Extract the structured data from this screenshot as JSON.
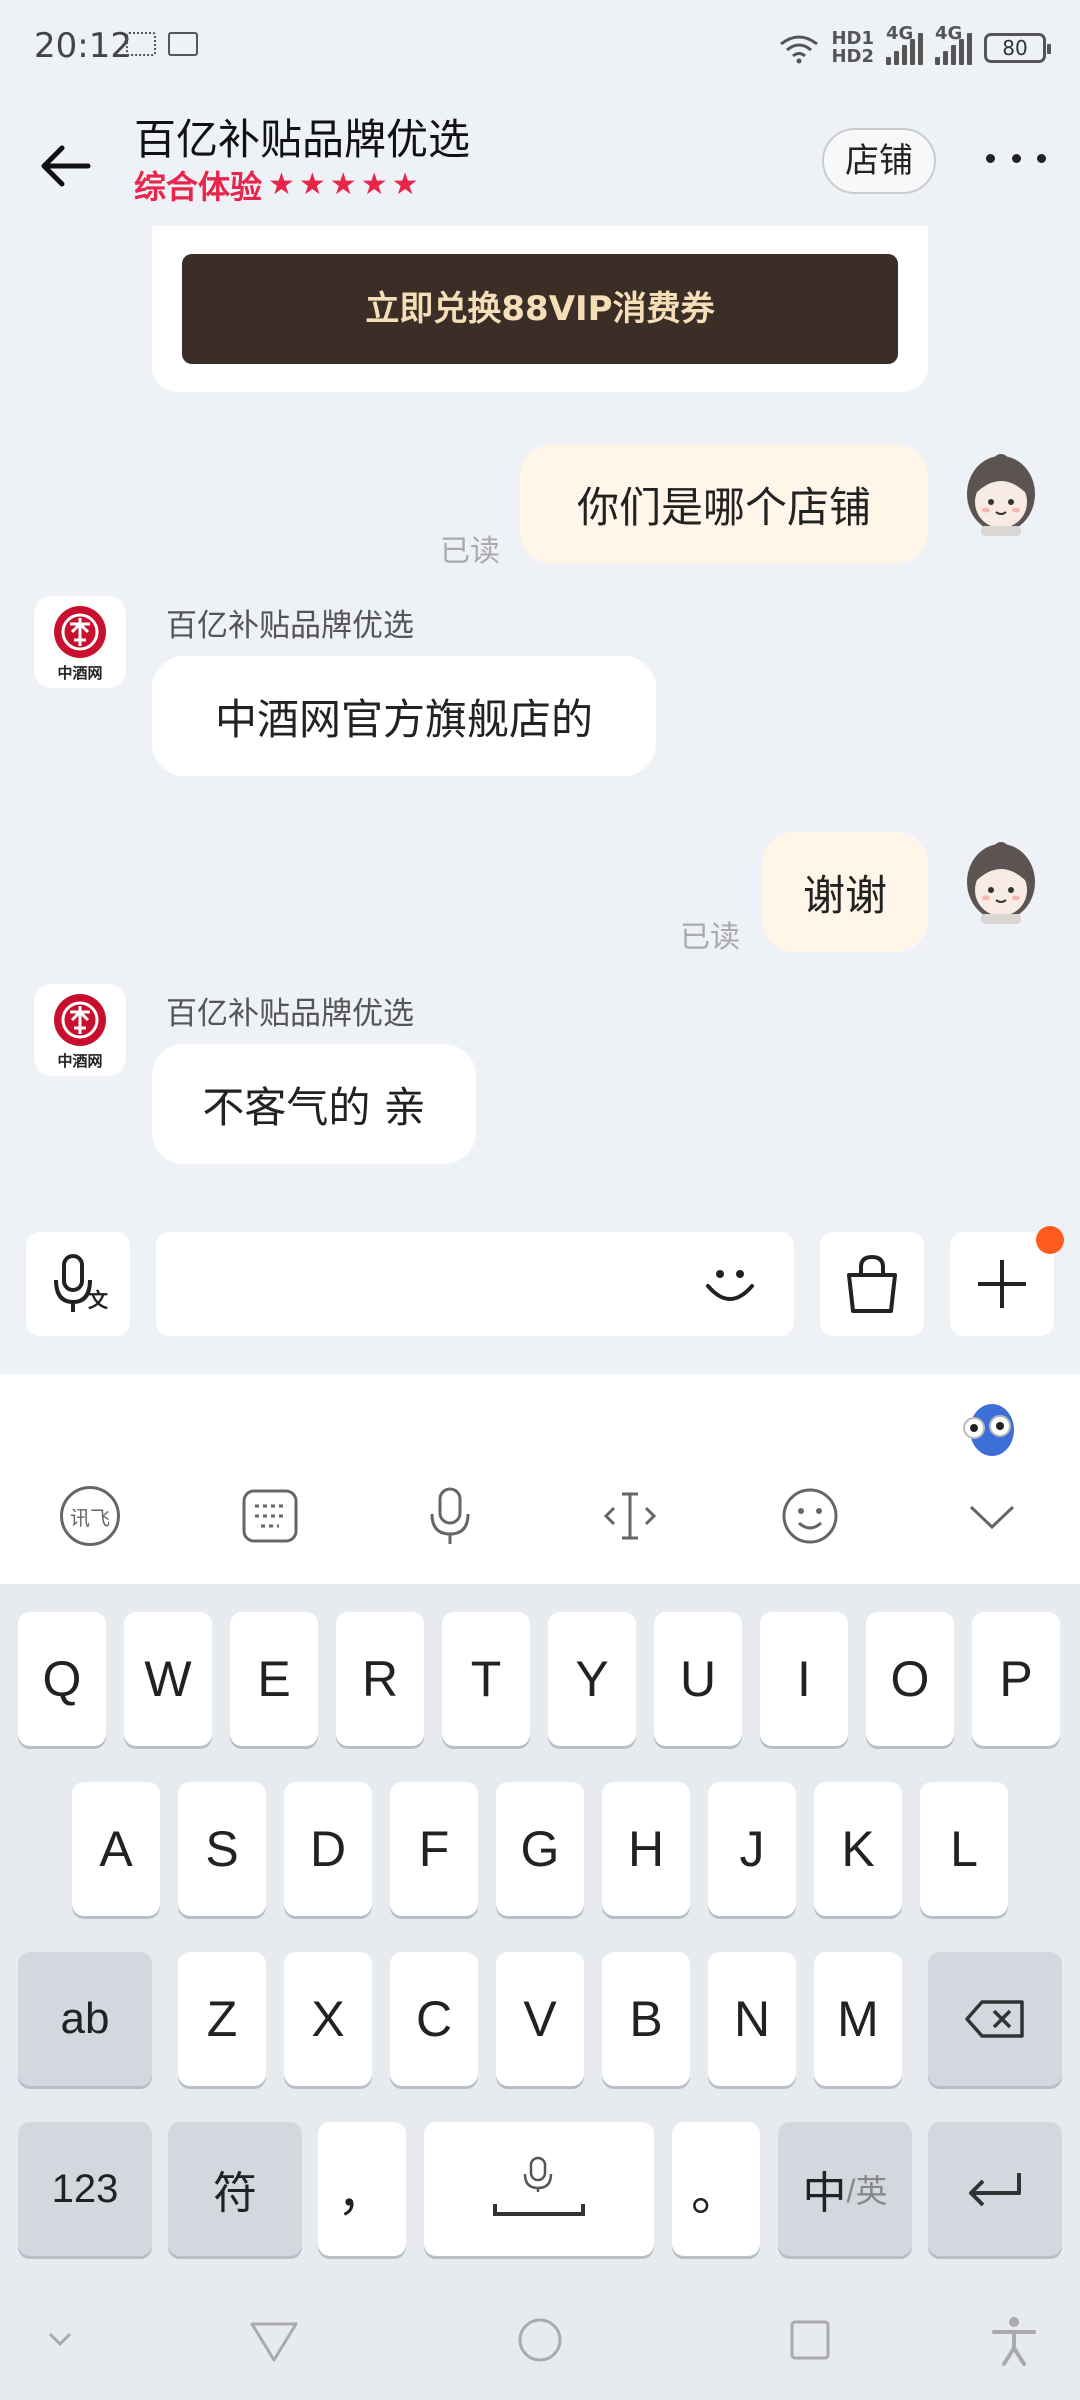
{
  "status_bar": {
    "time": "20:12",
    "network_labels": [
      "HD1",
      "HD2",
      "4G",
      "4G"
    ],
    "battery": "80"
  },
  "header": {
    "title": "百亿补贴品牌优选",
    "experience_label": "综合体验",
    "stars": "★★★★★",
    "store_button": "店铺"
  },
  "chat": {
    "promo_button": "立即兑换88VIP消费券",
    "messages": [
      {
        "sender": "me",
        "text": "你们是哪个店铺",
        "status": "已读"
      },
      {
        "sender": "shop",
        "name": "百亿补贴品牌优选",
        "text": "中酒网官方旗舰店的",
        "avatar_caption": "中酒网"
      },
      {
        "sender": "me",
        "text": "谢谢",
        "status": "已读"
      },
      {
        "sender": "shop",
        "name": "百亿补贴品牌优选",
        "text": "不客气的 亲",
        "avatar_caption": "中酒网"
      }
    ]
  },
  "input_bar": {
    "voice_icon_caption": "文",
    "text_value": "",
    "plus_has_badge": true
  },
  "keyboard": {
    "row1": [
      "Q",
      "W",
      "E",
      "R",
      "T",
      "Y",
      "U",
      "I",
      "O",
      "P"
    ],
    "row2": [
      "A",
      "S",
      "D",
      "F",
      "G",
      "H",
      "J",
      "K",
      "L"
    ],
    "row3": [
      "Z",
      "X",
      "C",
      "V",
      "B",
      "N",
      "M"
    ],
    "shift_label": "ab",
    "numbers_label": "123",
    "symbols_label": "符",
    "comma_label": "，",
    "period_label": "。",
    "lang_primary": "中",
    "lang_secondary": "/英",
    "ime_logo_label": "讯飞"
  },
  "colors": {
    "accent_red": "#e8254a",
    "vip_button_bg": "#3a2e26",
    "vip_button_text": "#f6dfb8",
    "my_bubble": "#fff5e8",
    "badge_orange": "#ff5a1f"
  }
}
